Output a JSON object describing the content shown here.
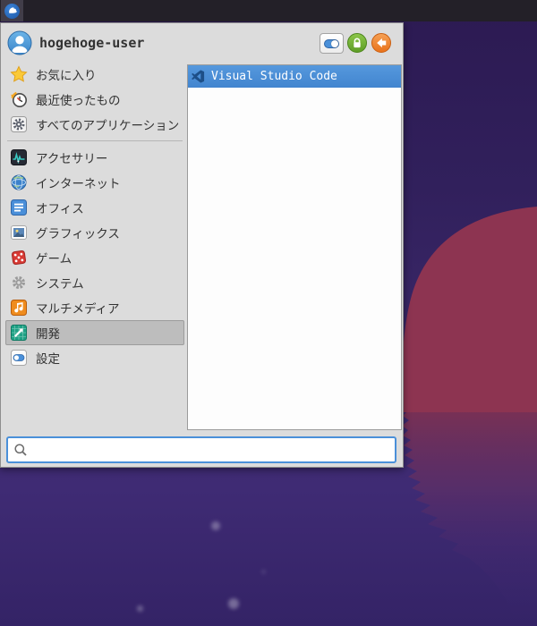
{
  "panel": {
    "whisker_button_icon": "whisker-menu-icon"
  },
  "menu": {
    "user": {
      "name": "hogehoge-user",
      "avatar_icon": "user-avatar"
    },
    "actions": {
      "settings_toggle_icon": "toggle-switch-icon",
      "lock_icon": "lock-icon",
      "logout_icon": "logout-arrow-icon"
    },
    "categories": [
      {
        "label": "お気に入り",
        "icon": "star-icon"
      },
      {
        "label": "最近使ったもの",
        "icon": "recent-clock-icon"
      },
      {
        "label": "すべてのアプリケーション",
        "icon": "all-applications-gear-icon"
      },
      {
        "label": "アクセサリー",
        "icon": "accessories-pulse-icon"
      },
      {
        "label": "インターネット",
        "icon": "internet-globe-icon"
      },
      {
        "label": "オフィス",
        "icon": "office-document-icon"
      },
      {
        "label": "グラフィックス",
        "icon": "graphics-photo-icon"
      },
      {
        "label": "ゲーム",
        "icon": "games-dice-icon"
      },
      {
        "label": "システム",
        "icon": "system-gear-icon"
      },
      {
        "label": "マルチメディア",
        "icon": "multimedia-note-icon"
      },
      {
        "label": "開発",
        "icon": "development-icon",
        "selected": true
      },
      {
        "label": "設定",
        "icon": "settings-toggle-icon"
      }
    ],
    "selected_category": "開発",
    "apps": [
      {
        "label": "Visual Studio Code",
        "icon": "vscode-icon",
        "selected": true
      }
    ],
    "search": {
      "value": "",
      "placeholder": "",
      "icon": "search-icon"
    }
  },
  "colors": {
    "selection_blue": "#4a90d9",
    "menu_bg": "#dcdcdc",
    "panel_bg": "#232028",
    "sun_red": "#8d3451",
    "sky_purple_top": "#2c1a52",
    "sky_purple_bottom": "#3f2b74"
  }
}
